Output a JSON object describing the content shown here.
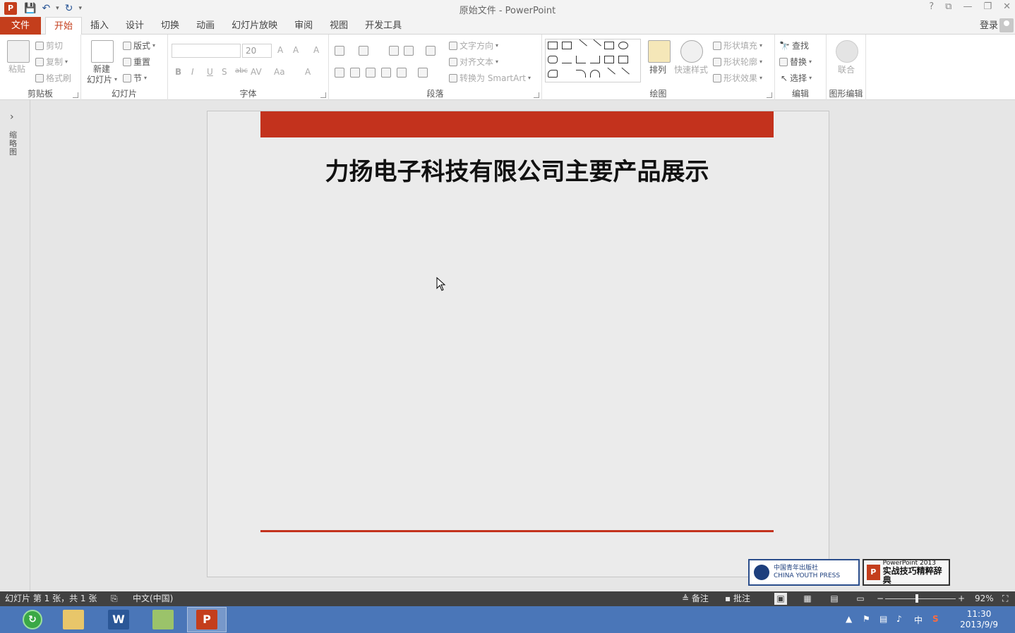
{
  "window": {
    "title": "原始文件 - PowerPoint",
    "app_icon": "P",
    "controls": [
      "?",
      "⧉",
      "—",
      "❐",
      "✕"
    ]
  },
  "qat": {
    "save": "💾",
    "undo": "↶",
    "redo": "↻",
    "customize": "▾"
  },
  "tabs": {
    "file": "文件",
    "items": [
      "开始",
      "插入",
      "设计",
      "切换",
      "动画",
      "幻灯片放映",
      "审阅",
      "视图",
      "开发工具"
    ],
    "active": "开始",
    "signin": "登录"
  },
  "ribbon": {
    "clipboard": {
      "label": "剪贴板",
      "paste": "粘贴",
      "cut": "剪切",
      "copy": "复制",
      "format_painter": "格式刷"
    },
    "slides": {
      "label": "幻灯片",
      "new_slide_line1": "新建",
      "new_slide_line2": "幻灯片",
      "layout": "版式",
      "reset": "重置",
      "section": "节"
    },
    "font": {
      "label": "字体",
      "font_name": "",
      "font_size": "20",
      "grow": "A",
      "shrink": "A",
      "clear": "A",
      "bold": "B",
      "italic": "I",
      "underline": "U",
      "shadow": "S",
      "strike": "abc",
      "spacing": "AV",
      "case": "Aa",
      "color": "A"
    },
    "paragraph": {
      "label": "段落",
      "text_direction": "文字方向",
      "align_text": "对齐文本",
      "smartart": "转换为 SmartArt"
    },
    "drawing": {
      "label": "绘图",
      "arrange": "排列",
      "quick_styles": "快速样式",
      "shape_fill": "形状填充",
      "shape_outline": "形状轮廓",
      "shape_effects": "形状效果"
    },
    "editing": {
      "label": "编辑",
      "find": "查找",
      "replace": "替换",
      "select": "选择"
    },
    "shape_edit": {
      "label": "图形编辑",
      "union": "联合"
    }
  },
  "thumbnail_pane": {
    "label": "缩略图"
  },
  "slide": {
    "title": "力扬电子科技有限公司主要产品展示",
    "accent_color": "#c3321d"
  },
  "watermark": {
    "press_line1": "中国青年出版社",
    "press_line2": "CHINA YOUTH PRESS",
    "book_line1": "PowerPoint 2013",
    "book_line2": "实战技巧精粹辞典"
  },
  "status": {
    "slide_info": "幻灯片 第 1 张，共 1 张",
    "language": "中文(中国)",
    "notes": "备注",
    "comments": "批注",
    "zoom": "92%"
  },
  "taskbar": {
    "apps": [
      "360",
      "资源管理器",
      "Word",
      "图片",
      "PowerPoint"
    ],
    "ime": "中",
    "sogou": "S",
    "time": "11:30",
    "date": "2013/9/9"
  }
}
